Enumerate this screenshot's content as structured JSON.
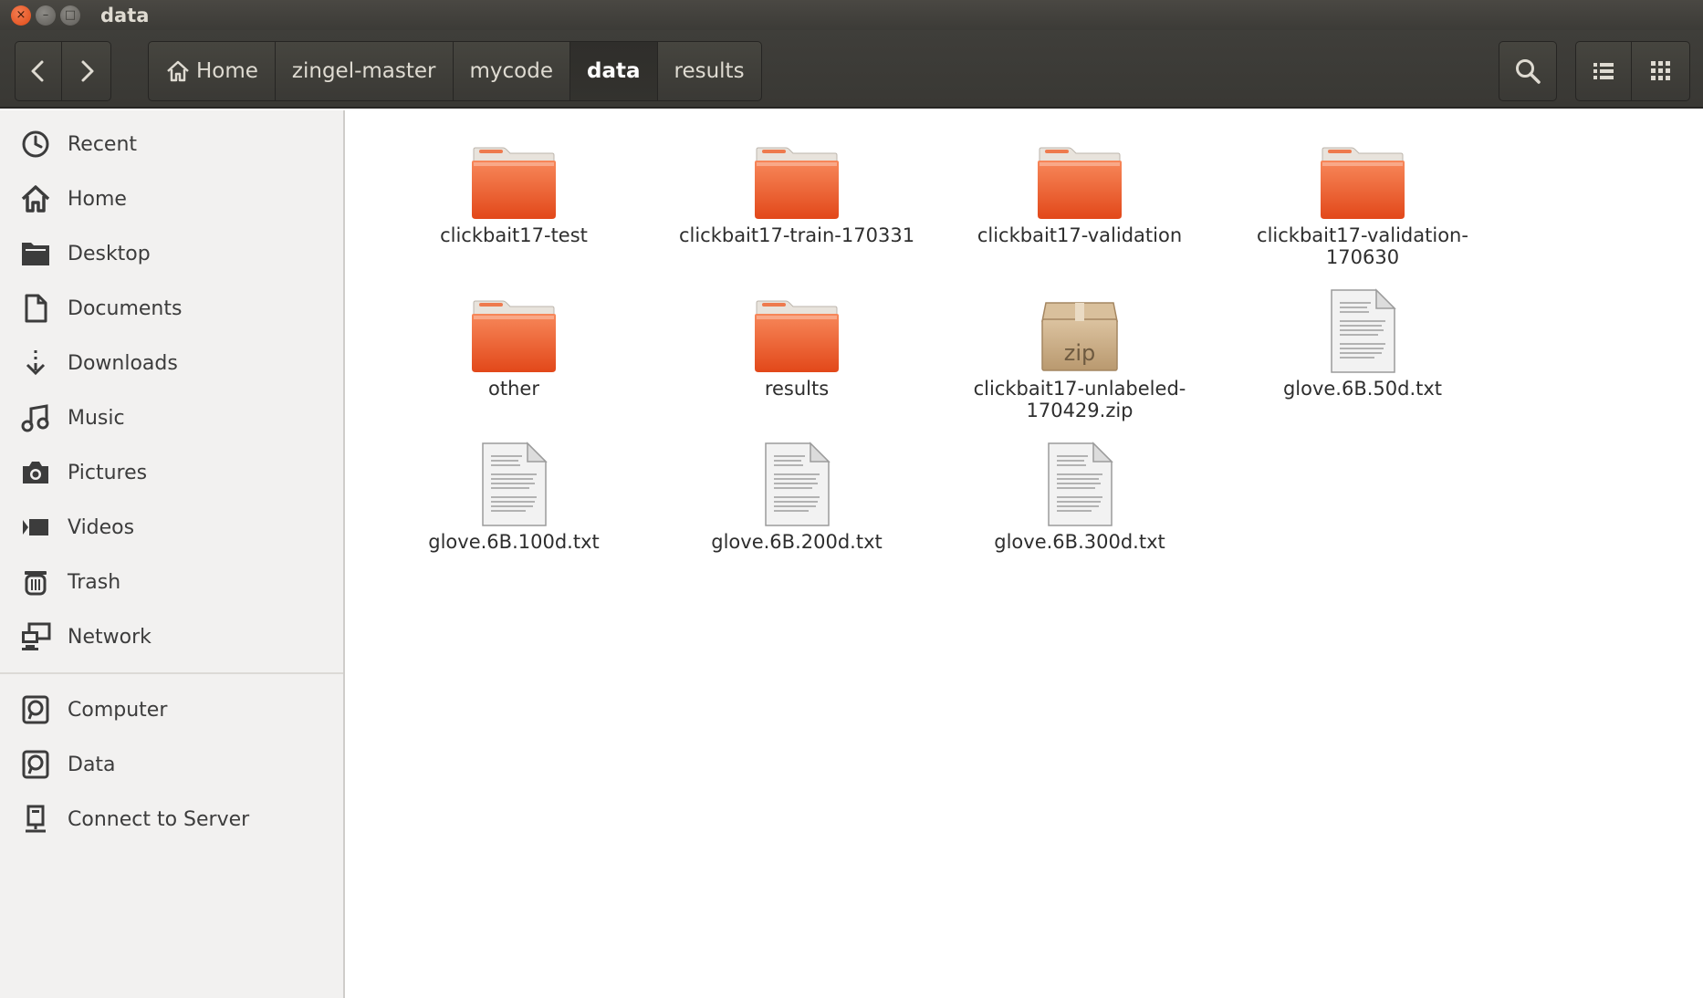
{
  "window": {
    "title": "data"
  },
  "titlebar_buttons": {
    "close": "×",
    "minimize": "–",
    "maximize": "□"
  },
  "toolbar": {
    "back_glyph": "‹",
    "forward_glyph": "›",
    "breadcrumbs": [
      {
        "label": "Home",
        "icon": "home-icon"
      },
      {
        "label": "zingel-master"
      },
      {
        "label": "mycode"
      },
      {
        "label": "data",
        "active": true
      },
      {
        "label": "results"
      }
    ]
  },
  "sidebar": {
    "places": [
      {
        "label": "Recent",
        "icon": "clock-icon"
      },
      {
        "label": "Home",
        "icon": "home-icon"
      },
      {
        "label": "Desktop",
        "icon": "desktop-icon"
      },
      {
        "label": "Documents",
        "icon": "document-icon"
      },
      {
        "label": "Downloads",
        "icon": "download-icon"
      },
      {
        "label": "Music",
        "icon": "music-icon"
      },
      {
        "label": "Pictures",
        "icon": "camera-icon"
      },
      {
        "label": "Videos",
        "icon": "video-icon"
      },
      {
        "label": "Trash",
        "icon": "trash-icon"
      },
      {
        "label": "Network",
        "icon": "network-icon"
      }
    ],
    "devices": [
      {
        "label": "Computer",
        "icon": "drive-icon"
      },
      {
        "label": "Data",
        "icon": "drive-icon"
      },
      {
        "label": "Connect to Server",
        "icon": "server-icon"
      }
    ]
  },
  "files": [
    {
      "name": "clickbait17-test",
      "type": "folder"
    },
    {
      "name": "clickbait17-train-170331",
      "type": "folder"
    },
    {
      "name": "clickbait17-validation",
      "type": "folder"
    },
    {
      "name": "clickbait17-validation-170630",
      "type": "folder"
    },
    {
      "name": "other",
      "type": "folder"
    },
    {
      "name": "results",
      "type": "folder"
    },
    {
      "name": "clickbait17-unlabeled-170429.zip",
      "type": "zip",
      "badge": "zip"
    },
    {
      "name": "glove.6B.50d.txt",
      "type": "text"
    },
    {
      "name": "glove.6B.100d.txt",
      "type": "text"
    },
    {
      "name": "glove.6B.200d.txt",
      "type": "text"
    },
    {
      "name": "glove.6B.300d.txt",
      "type": "text"
    }
  ],
  "colors": {
    "folder_top": "#f9a77a",
    "folder_body": "#ee5a24",
    "titlebar": "#3c3b37",
    "sidebar_bg": "#f2f1f0"
  }
}
